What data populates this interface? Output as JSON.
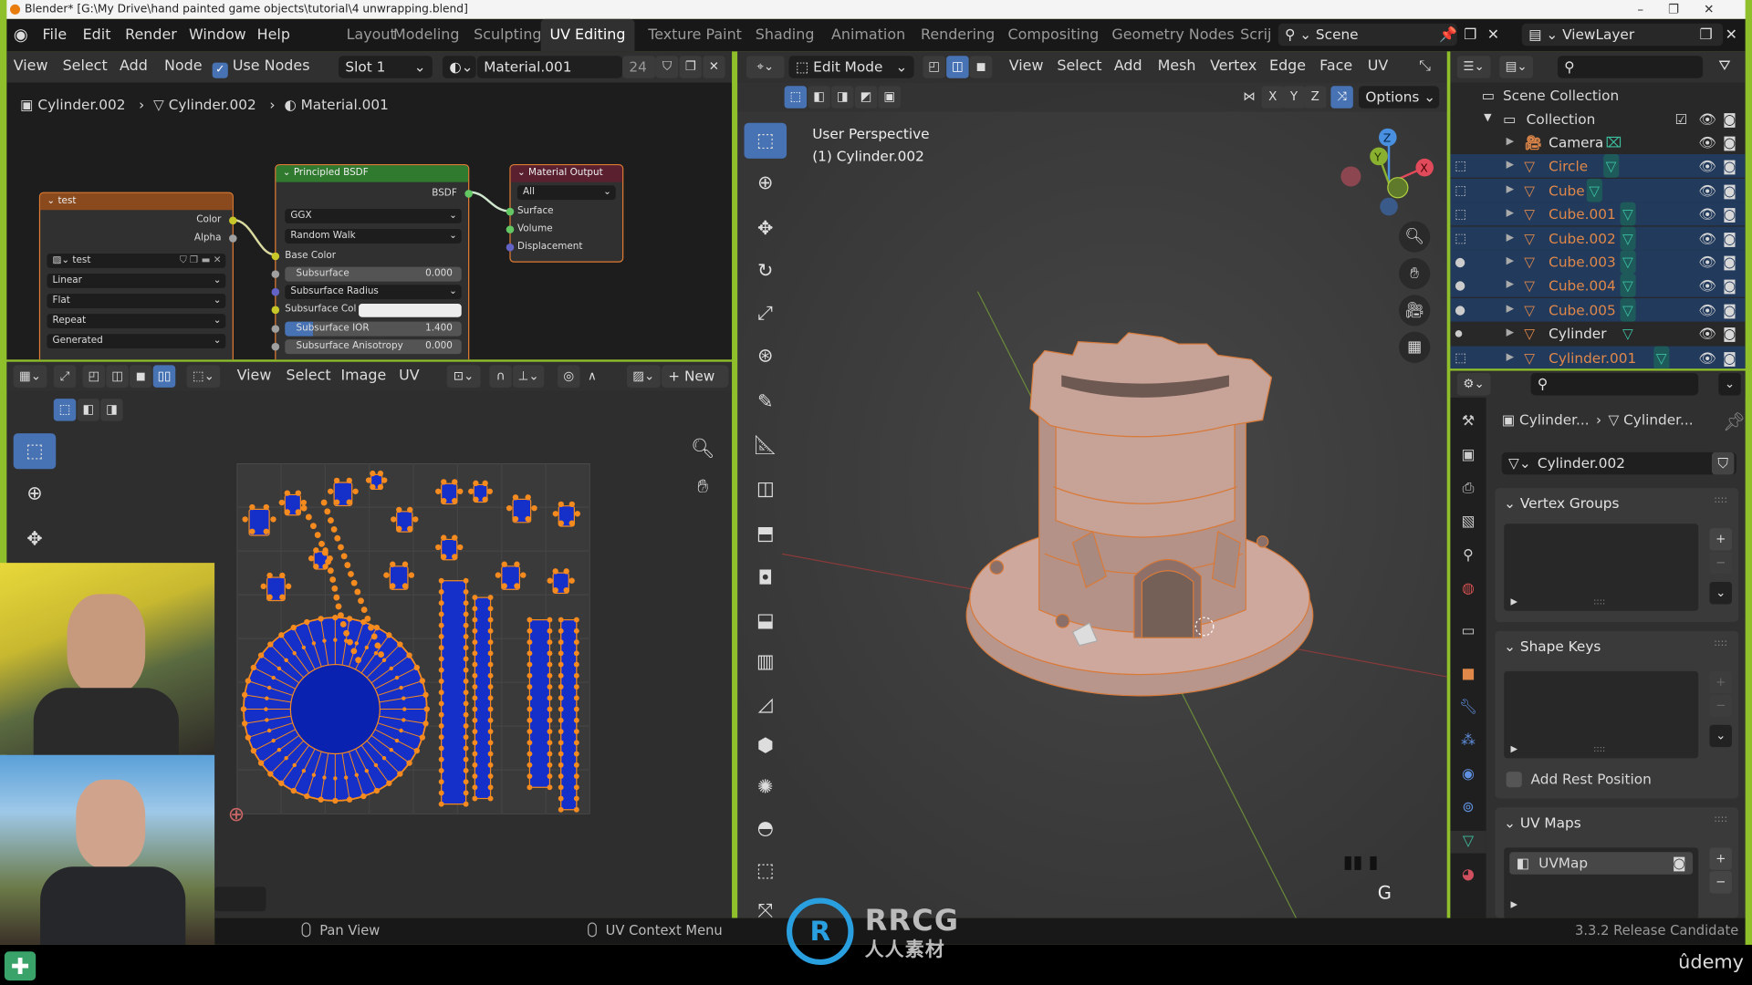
{
  "window": {
    "title": "Blender* [G:\\My Drive\\hand painted game objects\\tutorial\\4 unwrapping.blend]",
    "controls": [
      "–",
      "❐",
      "✕"
    ]
  },
  "menu": {
    "items": [
      "File",
      "Edit",
      "Render",
      "Window",
      "Help"
    ]
  },
  "workspaces": {
    "tabs": [
      "Layout",
      "Modeling",
      "Sculpting",
      "UV Editing",
      "Texture Paint",
      "Shading",
      "Animation",
      "Rendering",
      "Compositing",
      "Geometry Nodes",
      "Scrij"
    ],
    "active": "UV Editing"
  },
  "scene": {
    "name": "Scene",
    "view_layer": "ViewLayer"
  },
  "node_editor": {
    "header": {
      "menus": [
        "View",
        "Select",
        "Add",
        "Node"
      ],
      "use_nodes_label": "Use Nodes",
      "use_nodes_checked": true,
      "slot": "Slot 1",
      "material": "Material.001",
      "users": "24"
    },
    "breadcrumb": [
      "Cylinder.002",
      "Cylinder.002",
      "Material.001"
    ],
    "image_node": {
      "title": "test",
      "outputs": [
        "Color",
        "Alpha"
      ],
      "image": "test",
      "interpolation": "Linear",
      "projection": "Flat",
      "extension": "Repeat",
      "source": "Generated"
    },
    "bsdf_node": {
      "title": "Principled BSDF",
      "output": "BSDF",
      "distribution": "GGX",
      "subsurface_method": "Random Walk",
      "base_color": "Base Color",
      "fields": [
        {
          "label": "Subsurface",
          "value": "0.000"
        },
        {
          "label": "Subsurface Radius",
          "value": ""
        },
        {
          "label": "Subsurface Col",
          "value": ""
        },
        {
          "label": "Subsurface IOR",
          "value": "1.400"
        },
        {
          "label": "Subsurface Anisotropy",
          "value": "0.000"
        }
      ]
    },
    "output_node": {
      "title": "Material Output",
      "target": "All",
      "inputs": [
        "Surface",
        "Volume",
        "Displacement"
      ]
    }
  },
  "uv_editor": {
    "header": {
      "menus": [
        "View",
        "Select",
        "Image",
        "UV"
      ],
      "new_label": "New"
    }
  },
  "viewport": {
    "header": {
      "mode": "Edit Mode",
      "menus": [
        "View",
        "Select",
        "Add",
        "Mesh",
        "Vertex",
        "Edge",
        "Face",
        "UV"
      ],
      "axes": [
        "X",
        "Y",
        "Z"
      ],
      "options_label": "Options"
    },
    "overlay_text": [
      "User Perspective",
      "(1) Cylinder.002"
    ],
    "key_hint": "G",
    "gizmo_axes": [
      "X",
      "Y",
      "Z"
    ]
  },
  "outliner": {
    "root": "Scene Collection",
    "collection": "Collection",
    "items": [
      {
        "name": "Camera",
        "type": "camera",
        "selected": false
      },
      {
        "name": "Circle",
        "type": "mesh",
        "selected": true
      },
      {
        "name": "Cube",
        "type": "mesh",
        "selected": true
      },
      {
        "name": "Cube.001",
        "type": "mesh",
        "selected": true
      },
      {
        "name": "Cube.002",
        "type": "mesh",
        "selected": true
      },
      {
        "name": "Cube.003",
        "type": "mesh",
        "selected": true
      },
      {
        "name": "Cube.004",
        "type": "mesh",
        "selected": true
      },
      {
        "name": "Cube.005",
        "type": "mesh",
        "selected": true
      },
      {
        "name": "Cylinder",
        "type": "mesh",
        "selected": false
      },
      {
        "name": "Cylinder.001",
        "type": "mesh",
        "selected": true
      }
    ]
  },
  "properties": {
    "breadcrumb": [
      "Cylinder...",
      "Cylinder..."
    ],
    "mesh_name": "Cylinder.002",
    "tabs": [
      "tool",
      "render",
      "output",
      "view-layer",
      "scene",
      "world",
      "collection",
      "object",
      "modifiers",
      "particles",
      "physics",
      "constraints",
      "data",
      "material"
    ],
    "active_tab": "data",
    "panels": {
      "vertex_groups": "Vertex Groups",
      "shape_keys": "Shape Keys",
      "add_rest_position": "Add Rest Position",
      "uv_maps": "UV Maps",
      "uv_map_item": "UVMap"
    }
  },
  "statusbar": {
    "hints": [
      "Pan View",
      "UV Context Menu"
    ],
    "version": "3.3.2 Release Candidate"
  },
  "overlays": {
    "watermark": "RRCG 人人素材",
    "brand": "ûdemy"
  },
  "colors": {
    "accent": "#4772b3",
    "selection_orange": "#e0884a",
    "frame_green": "#8fbf2a",
    "uv_face": "#1530c8",
    "uv_vertex": "#f58a1f"
  }
}
